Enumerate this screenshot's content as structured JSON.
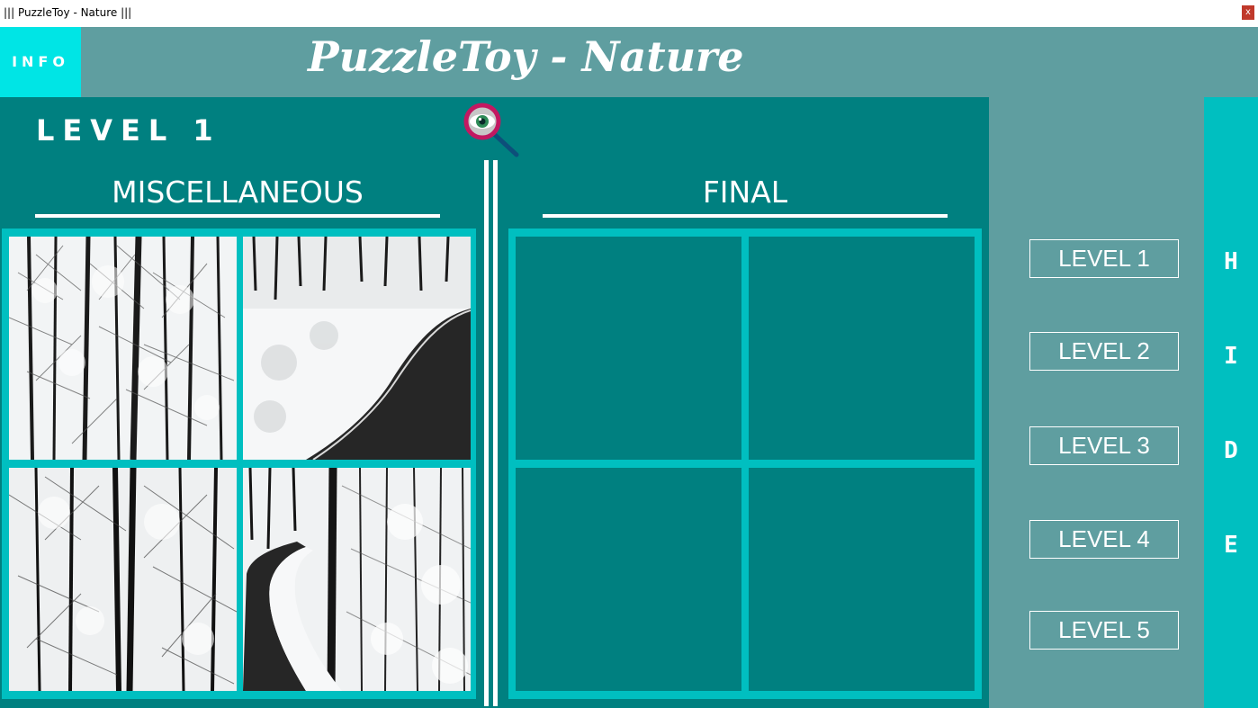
{
  "window": {
    "title": "||| PuzzleToy - Nature |||",
    "close_label": "x"
  },
  "header": {
    "info_label": "INFO",
    "app_title": "PuzzleToy - Nature"
  },
  "main": {
    "level_title": "LEVEL 1",
    "misc_heading": "MISCELLANEOUS",
    "final_heading": "FINAL"
  },
  "pieces": [
    {
      "subject": "snowy forest trees"
    },
    {
      "subject": "snowy road curve"
    },
    {
      "subject": "snowy forest trees"
    },
    {
      "subject": "snowy road through forest"
    }
  ],
  "sidebar": {
    "levels": [
      "LEVEL 1",
      "LEVEL 2",
      "LEVEL 3",
      "LEVEL 4",
      "LEVEL 5"
    ]
  },
  "hide_strip": {
    "letters": [
      "H",
      "I",
      "D",
      "E"
    ]
  },
  "colors": {
    "teal": "#008080",
    "cadet": "#5f9ea0",
    "cyan": "#00bfc0",
    "info_cyan": "#00e5e5",
    "close_red": "#c0392b"
  },
  "icons": {
    "preview": "eye-magnifier-icon",
    "close": "close-icon"
  }
}
